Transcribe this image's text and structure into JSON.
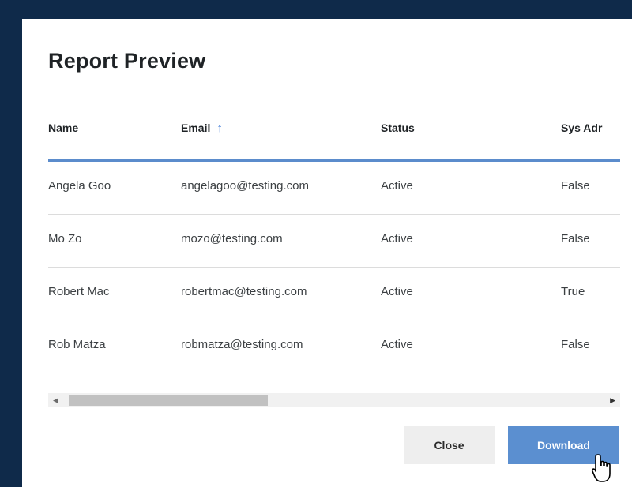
{
  "dialog": {
    "title": "Report Preview"
  },
  "table": {
    "columns": [
      {
        "label": "Name"
      },
      {
        "label": "Email",
        "sort": "ascending",
        "sort_icon": "arrow-up-icon"
      },
      {
        "label": "Status"
      },
      {
        "label": "Sys Adr"
      }
    ],
    "rows": [
      [
        "Angela Goo",
        "angelagoo@testing.com",
        "Active",
        "False"
      ],
      [
        "Mo Zo",
        "mozo@testing.com",
        "Active",
        "False"
      ],
      [
        "Robert Mac",
        "robertmac@testing.com",
        "Active",
        "True"
      ],
      [
        "Rob Matza",
        "robmatza@testing.com",
        "Active",
        "False"
      ]
    ]
  },
  "scrollbar": {
    "left_icon": "arrow-left-icon",
    "right_icon": "arrow-right-icon"
  },
  "buttons": {
    "close_label": "Close",
    "download_label": "Download"
  },
  "colors": {
    "frame": "#0f2a4a",
    "accent": "#5b8ccc",
    "primary_button": "#5b8fd0",
    "sort_arrow": "#2f6fd4"
  }
}
